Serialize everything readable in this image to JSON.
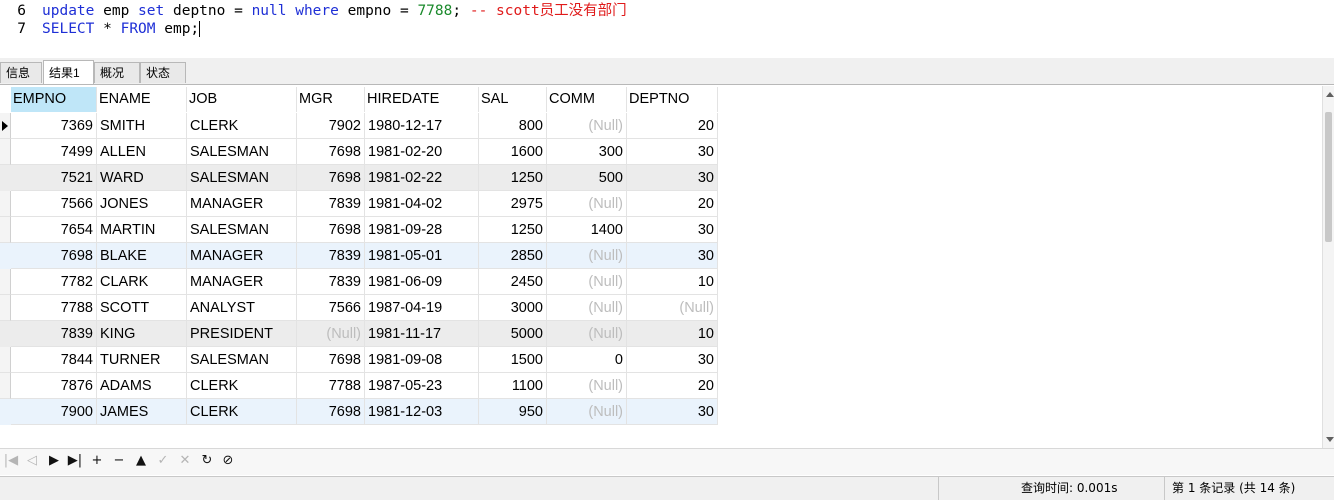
{
  "editor": {
    "lines": [
      {
        "number": "6",
        "tokens": [
          {
            "t": "kw",
            "v": "update"
          },
          {
            "t": "id",
            "v": " emp "
          },
          {
            "t": "kw",
            "v": "set"
          },
          {
            "t": "id",
            "v": " deptno = "
          },
          {
            "t": "kw",
            "v": "null"
          },
          {
            "t": "id",
            "v": " "
          },
          {
            "t": "kw",
            "v": "where"
          },
          {
            "t": "id",
            "v": " empno = "
          },
          {
            "t": "num",
            "v": "7788"
          },
          {
            "t": "id",
            "v": "; "
          },
          {
            "t": "cmt",
            "v": "-- scott员工没有部门"
          }
        ]
      },
      {
        "number": "7",
        "tokens": [
          {
            "t": "kw",
            "v": "SELECT"
          },
          {
            "t": "id",
            "v": " * "
          },
          {
            "t": "kw",
            "v": "FROM"
          },
          {
            "t": "id",
            "v": " emp;"
          }
        ]
      }
    ]
  },
  "tabs": [
    {
      "label": "信息",
      "active": false
    },
    {
      "label": "结果1",
      "active": true
    },
    {
      "label": "概况",
      "active": false
    },
    {
      "label": "状态",
      "active": false
    }
  ],
  "grid": {
    "columns": [
      "EMPNO",
      "ENAME",
      "JOB",
      "MGR",
      "HIREDATE",
      "SAL",
      "COMM",
      "DEPTNO"
    ],
    "rows": [
      [
        "7369",
        "SMITH",
        "CLERK",
        "7902",
        "1980-12-17",
        "800",
        "(Null)",
        "20"
      ],
      [
        "7499",
        "ALLEN",
        "SALESMAN",
        "7698",
        "1981-02-20",
        "1600",
        "300",
        "30"
      ],
      [
        "7521",
        "WARD",
        "SALESMAN",
        "7698",
        "1981-02-22",
        "1250",
        "500",
        "30"
      ],
      [
        "7566",
        "JONES",
        "MANAGER",
        "7839",
        "1981-04-02",
        "2975",
        "(Null)",
        "20"
      ],
      [
        "7654",
        "MARTIN",
        "SALESMAN",
        "7698",
        "1981-09-28",
        "1250",
        "1400",
        "30"
      ],
      [
        "7698",
        "BLAKE",
        "MANAGER",
        "7839",
        "1981-05-01",
        "2850",
        "(Null)",
        "30"
      ],
      [
        "7782",
        "CLARK",
        "MANAGER",
        "7839",
        "1981-06-09",
        "2450",
        "(Null)",
        "10"
      ],
      [
        "7788",
        "SCOTT",
        "ANALYST",
        "7566",
        "1987-04-19",
        "3000",
        "(Null)",
        "(Null)"
      ],
      [
        "7839",
        "KING",
        "PRESIDENT",
        "(Null)",
        "1981-11-17",
        "5000",
        "(Null)",
        "10"
      ],
      [
        "7844",
        "TURNER",
        "SALESMAN",
        "7698",
        "1981-09-08",
        "1500",
        "0",
        "30"
      ],
      [
        "7876",
        "ADAMS",
        "CLERK",
        "7788",
        "1987-05-23",
        "1100",
        "(Null)",
        "20"
      ],
      [
        "7900",
        "JAMES",
        "CLERK",
        "7698",
        "1981-12-03",
        "950",
        "(Null)",
        "30"
      ]
    ],
    "current_row": 0,
    "shaded_rows": [
      2,
      8
    ],
    "highlighted_rows": [
      5,
      11
    ]
  },
  "toolbar": {
    "buttons": [
      {
        "name": "first-record-button",
        "glyph": "|◀",
        "enabled": false
      },
      {
        "name": "prev-record-button",
        "glyph": "◁",
        "enabled": false
      },
      {
        "name": "next-record-button",
        "glyph": "▶",
        "enabled": true
      },
      {
        "name": "last-record-button",
        "glyph": "▶|",
        "enabled": true
      },
      {
        "name": "add-record-button",
        "glyph": "+",
        "enabled": true
      },
      {
        "name": "delete-record-button",
        "glyph": "−",
        "enabled": true
      },
      {
        "name": "apply-button",
        "glyph": "▲",
        "enabled": true
      },
      {
        "name": "confirm-button",
        "glyph": "✓",
        "enabled": false
      },
      {
        "name": "discard-button",
        "glyph": "✕",
        "enabled": false
      },
      {
        "name": "refresh-button",
        "glyph": "↻",
        "enabled": true
      },
      {
        "name": "stop-button",
        "glyph": "⊘",
        "enabled": true
      }
    ]
  },
  "status": {
    "query_time": "查询时间: 0.001s",
    "record_info": "第 1 条记录 (共 14 条)"
  }
}
